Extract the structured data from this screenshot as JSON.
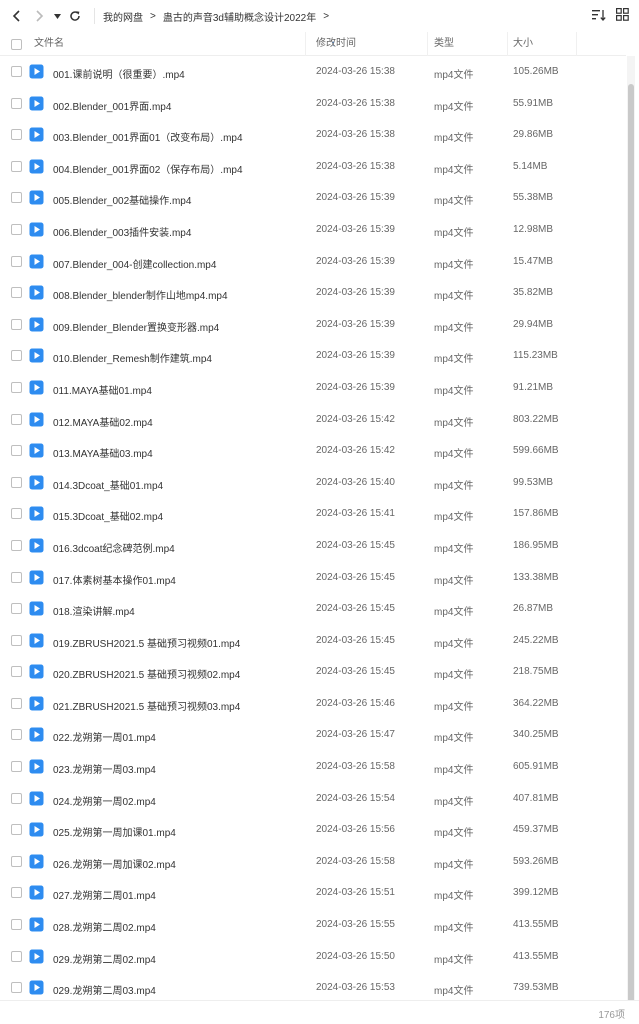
{
  "breadcrumb": [
    "我的网盘",
    "蛊古的声音3d辅助概念设计2022年"
  ],
  "breadcrumb_sep": ">",
  "columns": {
    "name": "文件名",
    "date": "修改时间",
    "type": "类型",
    "size": "大小"
  },
  "colors": {
    "accent": "#1a7cf3",
    "icon": "#2e8cf0"
  },
  "rows": [
    {
      "name": "001.课前说明（很重要）.mp4",
      "date": "2024-03-26 15:38",
      "type": "mp4文件",
      "size": "105.26MB"
    },
    {
      "name": "002.Blender_001界面.mp4",
      "date": "2024-03-26 15:38",
      "type": "mp4文件",
      "size": "55.91MB"
    },
    {
      "name": "003.Blender_001界面01（改变布局）.mp4",
      "date": "2024-03-26 15:38",
      "type": "mp4文件",
      "size": "29.86MB"
    },
    {
      "name": "004.Blender_001界面02（保存布局）.mp4",
      "date": "2024-03-26 15:38",
      "type": "mp4文件",
      "size": "5.14MB"
    },
    {
      "name": "005.Blender_002基础操作.mp4",
      "date": "2024-03-26 15:39",
      "type": "mp4文件",
      "size": "55.38MB"
    },
    {
      "name": "006.Blender_003插件安装.mp4",
      "date": "2024-03-26 15:39",
      "type": "mp4文件",
      "size": "12.98MB"
    },
    {
      "name": "007.Blender_004-创建collection.mp4",
      "date": "2024-03-26 15:39",
      "type": "mp4文件",
      "size": "15.47MB"
    },
    {
      "name": "008.Blender_blender制作山地mp4.mp4",
      "date": "2024-03-26 15:39",
      "type": "mp4文件",
      "size": "35.82MB"
    },
    {
      "name": "009.Blender_Blender置换变形器.mp4",
      "date": "2024-03-26 15:39",
      "type": "mp4文件",
      "size": "29.94MB"
    },
    {
      "name": "010.Blender_Remesh制作建筑.mp4",
      "date": "2024-03-26 15:39",
      "type": "mp4文件",
      "size": "115.23MB"
    },
    {
      "name": "011.MAYA基础01.mp4",
      "date": "2024-03-26 15:39",
      "type": "mp4文件",
      "size": "91.21MB"
    },
    {
      "name": "012.MAYA基础02.mp4",
      "date": "2024-03-26 15:42",
      "type": "mp4文件",
      "size": "803.22MB"
    },
    {
      "name": "013.MAYA基础03.mp4",
      "date": "2024-03-26 15:42",
      "type": "mp4文件",
      "size": "599.66MB"
    },
    {
      "name": "014.3Dcoat_基础01.mp4",
      "date": "2024-03-26 15:40",
      "type": "mp4文件",
      "size": "99.53MB"
    },
    {
      "name": "015.3Dcoat_基础02.mp4",
      "date": "2024-03-26 15:41",
      "type": "mp4文件",
      "size": "157.86MB"
    },
    {
      "name": "016.3dcoat纪念碑范例.mp4",
      "date": "2024-03-26 15:45",
      "type": "mp4文件",
      "size": "186.95MB"
    },
    {
      "name": "017.体素树基本操作01.mp4",
      "date": "2024-03-26 15:45",
      "type": "mp4文件",
      "size": "133.38MB"
    },
    {
      "name": "018.渲染讲解.mp4",
      "date": "2024-03-26 15:45",
      "type": "mp4文件",
      "size": "26.87MB"
    },
    {
      "name": "019.ZBRUSH2021.5 基础预习视频01.mp4",
      "date": "2024-03-26 15:45",
      "type": "mp4文件",
      "size": "245.22MB"
    },
    {
      "name": "020.ZBRUSH2021.5 基础预习视频02.mp4",
      "date": "2024-03-26 15:45",
      "type": "mp4文件",
      "size": "218.75MB"
    },
    {
      "name": "021.ZBRUSH2021.5 基础预习视频03.mp4",
      "date": "2024-03-26 15:46",
      "type": "mp4文件",
      "size": "364.22MB"
    },
    {
      "name": "022.龙朔第一周01.mp4",
      "date": "2024-03-26 15:47",
      "type": "mp4文件",
      "size": "340.25MB"
    },
    {
      "name": "023.龙朔第一周03.mp4",
      "date": "2024-03-26 15:58",
      "type": "mp4文件",
      "size": "605.91MB"
    },
    {
      "name": "024.龙朔第一周02.mp4",
      "date": "2024-03-26 15:54",
      "type": "mp4文件",
      "size": "407.81MB"
    },
    {
      "name": "025.龙朔第一周加课01.mp4",
      "date": "2024-03-26 15:56",
      "type": "mp4文件",
      "size": "459.37MB"
    },
    {
      "name": "026.龙朔第一周加课02.mp4",
      "date": "2024-03-26 15:58",
      "type": "mp4文件",
      "size": "593.26MB"
    },
    {
      "name": "027.龙朔第二周01.mp4",
      "date": "2024-03-26 15:51",
      "type": "mp4文件",
      "size": "399.12MB"
    },
    {
      "name": "028.龙朔第二周02.mp4",
      "date": "2024-03-26 15:55",
      "type": "mp4文件",
      "size": "413.55MB"
    },
    {
      "name": "029.龙朔第二周02.mp4",
      "date": "2024-03-26 15:50",
      "type": "mp4文件",
      "size": "413.55MB"
    },
    {
      "name": "029.龙朔第二周03.mp4",
      "date": "2024-03-26 15:53",
      "type": "mp4文件",
      "size": "739.53MB"
    }
  ],
  "footer": {
    "count": "176项"
  }
}
